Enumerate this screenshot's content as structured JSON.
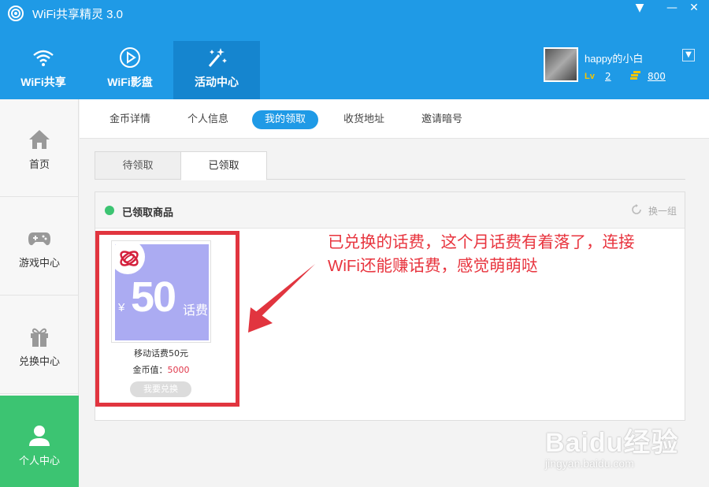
{
  "app": {
    "title": "WiFi共享精灵 3.0"
  },
  "window_controls": {
    "dropdown": "▼",
    "minimize": "—",
    "close": "✕"
  },
  "nav": {
    "tabs": [
      {
        "label": "WiFi共享",
        "icon": "wifi-icon"
      },
      {
        "label": "WiFi影盘",
        "icon": "play-icon"
      },
      {
        "label": "活动中心",
        "icon": "magic-wand-icon",
        "active": true
      }
    ]
  },
  "user": {
    "name": "happy的小白",
    "level_label": "Lv",
    "level": "2",
    "coins": "800"
  },
  "sidebar": {
    "items": [
      {
        "label": "首页",
        "icon": "home-icon"
      },
      {
        "label": "游戏中心",
        "icon": "gamepad-icon"
      },
      {
        "label": "兑换中心",
        "icon": "gift-icon"
      },
      {
        "label": "个人中心",
        "icon": "person-icon",
        "active": true
      }
    ]
  },
  "subtabs": [
    {
      "label": "金币详情"
    },
    {
      "label": "个人信息"
    },
    {
      "label": "我的领取",
      "active": true
    },
    {
      "label": "收货地址"
    },
    {
      "label": "邀请暗号"
    }
  ],
  "inner_tabs": [
    {
      "label": "待领取"
    },
    {
      "label": "已领取",
      "active": true
    }
  ],
  "panel": {
    "title": "已领取商品",
    "refresh_label": "换一组"
  },
  "product": {
    "yen": "¥",
    "amount": "50",
    "amount_unit": "话费",
    "name": "移动话费50元",
    "price_label": "金币值：",
    "price_value": "5000",
    "button": "我要兑换"
  },
  "annotation": {
    "line1": "已兑换的话费，这个月话费有着落了，连接",
    "line2_wifi": "WiFi",
    "line2_rest": "还能赚话费，感觉萌萌哒"
  },
  "watermark": {
    "main": "Baidu经验",
    "sub": "jingyan.baidu.com"
  },
  "colors": {
    "header_blue": "#1f9ae6",
    "active_green": "#3cc472",
    "annotation_red": "#e1353f",
    "product_bg": "#ababf2"
  }
}
